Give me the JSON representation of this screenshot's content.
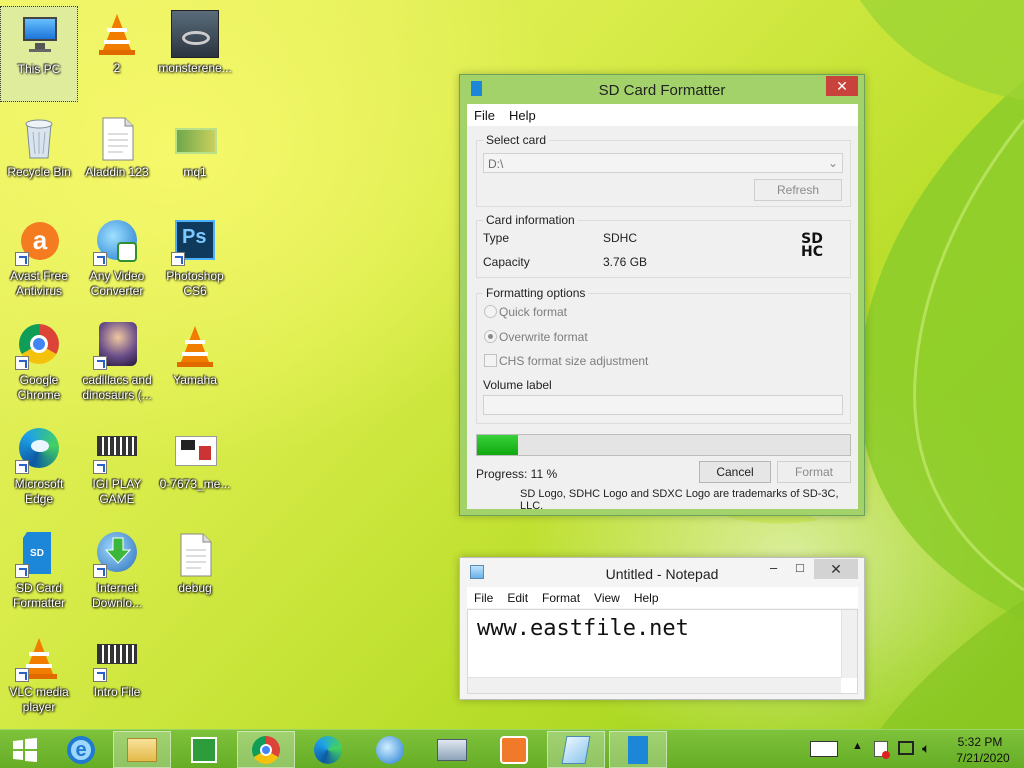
{
  "desktop": {
    "icons": [
      {
        "label": "This PC"
      },
      {
        "label": "2"
      },
      {
        "label": "monsterene..."
      },
      {
        "label": "Recycle Bin"
      },
      {
        "label": "Aladdin 123"
      },
      {
        "label": "mq1"
      },
      {
        "label": "Avast Free Antivirus"
      },
      {
        "label": "Any Video Converter"
      },
      {
        "label": "Photoshop CS6"
      },
      {
        "label": "Google Chrome"
      },
      {
        "label": "cadillacs and dinosaurs (..."
      },
      {
        "label": "Yamaha"
      },
      {
        "label": "Microsoft Edge"
      },
      {
        "label": "IGI PLAY GAME"
      },
      {
        "label": "0-7673_me..."
      },
      {
        "label": "SD Card Formatter"
      },
      {
        "label": "Internet Downlo..."
      },
      {
        "label": "debug"
      },
      {
        "label": "VLC media player"
      },
      {
        "label": "Intro File"
      }
    ]
  },
  "sdformatter": {
    "title": "SD Card Formatter",
    "menu": [
      "File",
      "Help"
    ],
    "select_card": {
      "group_label": "Select card",
      "drive": "D:\\",
      "refresh": "Refresh"
    },
    "card_info": {
      "group_label": "Card information",
      "type_label": "Type",
      "type_value": "SDHC",
      "capacity_label": "Capacity",
      "capacity_value": "3.76 GB",
      "logo_text": "SD HC"
    },
    "options": {
      "group_label": "Formatting options",
      "quick": "Quick format",
      "overwrite": "Overwrite format",
      "chs": "CHS format size adjustment",
      "volume_label": "Volume label",
      "volume_value": ""
    },
    "progress_fraction": 0.11,
    "progress_text": "Progress:  11 %",
    "cancel": "Cancel",
    "format": "Format",
    "trademark": "SD Logo, SDHC Logo and SDXC Logo are trademarks of SD-3C, LLC."
  },
  "notepad": {
    "title": "Untitled - Notepad",
    "menu": [
      "File",
      "Edit",
      "Format",
      "View",
      "Help"
    ],
    "content": "www.eastfile.net"
  },
  "taskbar": {
    "time": "5:32 PM",
    "date": "7/21/2020",
    "colors": {
      "bar": "#70b52e",
      "start": "#ffffff"
    }
  }
}
